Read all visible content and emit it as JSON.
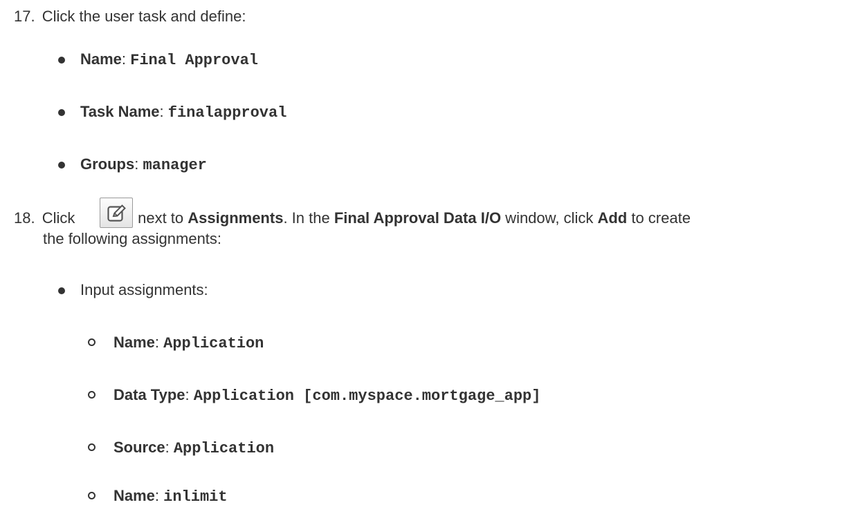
{
  "step17": {
    "number": "17.",
    "text": "Click the user task and define:",
    "items": [
      {
        "label": "Name",
        "sep": ": ",
        "value": "Final Approval"
      },
      {
        "label": "Task Name",
        "sep": ": ",
        "value": "finalapproval"
      },
      {
        "label": "Groups",
        "sep": ": ",
        "value": "manager"
      }
    ]
  },
  "step18": {
    "number": "18.",
    "click": "Click",
    "edit_icon": "edit-icon",
    "next_to": " next to ",
    "assignments": "Assignments",
    "in_the": ". In the ",
    "window_title": "Final Approval Data I/O",
    "window_click": " window, click ",
    "add": "Add",
    "to_create": " to create",
    "line2": "the following assignments:",
    "input_assignments": "Input assignments:",
    "sub_items": [
      {
        "label": "Name",
        "sep": ": ",
        "value": "Application"
      },
      {
        "label": "Data Type",
        "sep": ": ",
        "value": "Application [com.myspace.mortgage_app]"
      },
      {
        "label": "Source",
        "sep": ": ",
        "value": "Application"
      },
      {
        "label": "Name",
        "sep": ": ",
        "value": "inlimit"
      }
    ]
  }
}
